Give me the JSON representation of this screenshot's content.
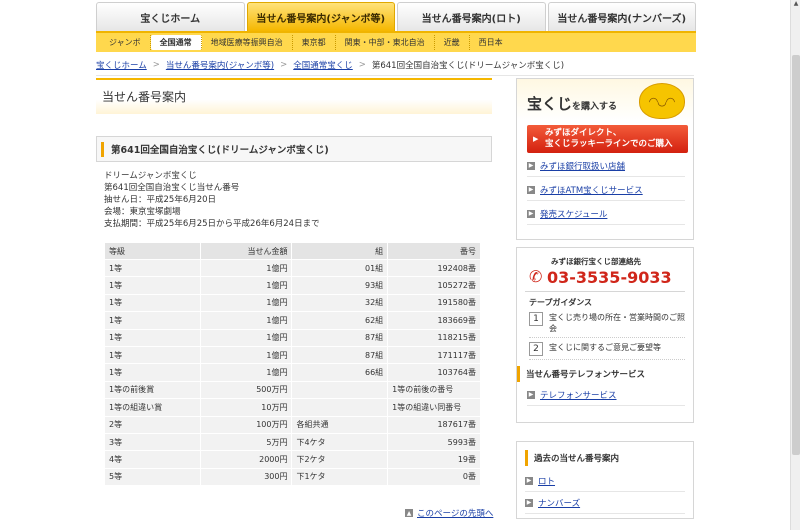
{
  "tabs": [
    {
      "label": "宝くじホーム",
      "active": false
    },
    {
      "label": "当せん番号案内(ジャンボ等)",
      "active": true
    },
    {
      "label": "当せん番号案内(ロト)",
      "active": false
    },
    {
      "label": "当せん番号案内(ナンバーズ)",
      "active": false
    }
  ],
  "subnav": [
    "ジャンボ",
    "全国通常",
    "地域医療等振興自治",
    "東京都",
    "関東・中部・東北自治",
    "近畿",
    "西日本"
  ],
  "breadcrumb": {
    "items": [
      "宝くじホーム",
      "当せん番号案内(ジャンボ等)",
      "全国通常宝くじ"
    ],
    "current": "第641回全国自治宝くじ(ドリームジャンボ宝くじ)",
    "separator": ">"
  },
  "page_title": "当せん番号案内",
  "section_title": "第641回全国自治宝くじ(ドリームジャンボ宝くじ)",
  "info": {
    "line1": "ドリームジャンボ宝くじ",
    "line2": "第641回全国自治宝くじ当せん番号",
    "line3": "抽せん日：平成25年6月20日",
    "line4": "会場：東京宝塚劇場",
    "line5": "支払期間：平成25年6月25日から平成26年6月24日まで"
  },
  "table": {
    "headers": [
      "等級",
      "当せん金額",
      "組",
      "番号"
    ],
    "rows": [
      [
        "1等",
        "1億円",
        "01組",
        "192408番"
      ],
      [
        "1等",
        "1億円",
        "93組",
        "105272番"
      ],
      [
        "1等",
        "1億円",
        "32組",
        "191580番"
      ],
      [
        "1等",
        "1億円",
        "62組",
        "183669番"
      ],
      [
        "1等",
        "1億円",
        "87組",
        "118215番"
      ],
      [
        "1等",
        "1億円",
        "87組",
        "171117番"
      ],
      [
        "1等",
        "1億円",
        "66組",
        "103764番"
      ],
      [
        "1等の前後賞",
        "500万円",
        "",
        "1等の前後の番号"
      ],
      [
        "1等の組違い賞",
        "10万円",
        "",
        "1等の組違い同番号"
      ],
      [
        "2等",
        "100万円",
        "各組共通",
        "187617番"
      ],
      [
        "3等",
        "5万円",
        "下4ケタ",
        "5993番"
      ],
      [
        "4等",
        "2000円",
        "下2ケタ",
        "19番"
      ],
      [
        "5等",
        "300円",
        "下1ケタ",
        "0番"
      ]
    ]
  },
  "page_top": "このページの先頭へ",
  "buy_box": {
    "title": "宝くじ",
    "title_suffix": "を購入する",
    "red_button_line1": "みずほダイレクト、",
    "red_button_line2": "宝くじラッキーラインでのご購入",
    "links": [
      "みずほ銀行取扱い店舗",
      "みずほATM宝くじサービス",
      "発売スケジュール"
    ]
  },
  "phone_box": {
    "caption": "みずほ銀行宝くじ部連絡先",
    "number": "03-3535-9033",
    "guide_title": "テープガイダンス",
    "guides": [
      {
        "num": "1",
        "text": "宝くじ売り場の所在・営業時間のご照会"
      },
      {
        "num": "2",
        "text": "宝くじに関するご意見ご要望等"
      }
    ],
    "service_title": "当せん番号テレフォンサービス",
    "service_link": "テレフォンサービス"
  },
  "past_box": {
    "title": "過去の当せん番号案内",
    "links": [
      "ロト",
      "ナンバーズ"
    ]
  },
  "colors": {
    "accent": "#f5b700",
    "subnav_bg": "#ffd84d",
    "link": "#1a3fa6",
    "alert_red": "#d0261a"
  }
}
